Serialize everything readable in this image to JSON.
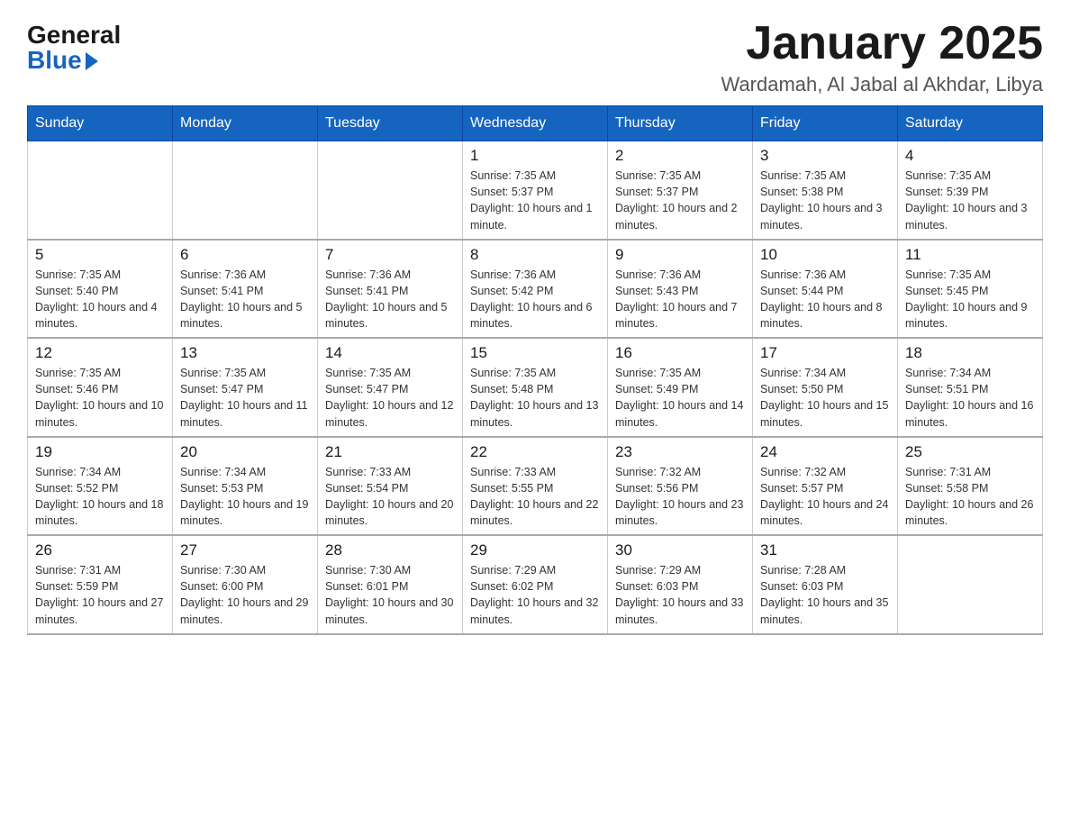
{
  "logo": {
    "general": "General",
    "blue": "Blue"
  },
  "title": "January 2025",
  "subtitle": "Wardamah, Al Jabal al Akhdar, Libya",
  "days_of_week": [
    "Sunday",
    "Monday",
    "Tuesday",
    "Wednesday",
    "Thursday",
    "Friday",
    "Saturday"
  ],
  "weeks": [
    [
      {
        "day": "",
        "info": ""
      },
      {
        "day": "",
        "info": ""
      },
      {
        "day": "",
        "info": ""
      },
      {
        "day": "1",
        "info": "Sunrise: 7:35 AM\nSunset: 5:37 PM\nDaylight: 10 hours and 1 minute."
      },
      {
        "day": "2",
        "info": "Sunrise: 7:35 AM\nSunset: 5:37 PM\nDaylight: 10 hours and 2 minutes."
      },
      {
        "day": "3",
        "info": "Sunrise: 7:35 AM\nSunset: 5:38 PM\nDaylight: 10 hours and 3 minutes."
      },
      {
        "day": "4",
        "info": "Sunrise: 7:35 AM\nSunset: 5:39 PM\nDaylight: 10 hours and 3 minutes."
      }
    ],
    [
      {
        "day": "5",
        "info": "Sunrise: 7:35 AM\nSunset: 5:40 PM\nDaylight: 10 hours and 4 minutes."
      },
      {
        "day": "6",
        "info": "Sunrise: 7:36 AM\nSunset: 5:41 PM\nDaylight: 10 hours and 5 minutes."
      },
      {
        "day": "7",
        "info": "Sunrise: 7:36 AM\nSunset: 5:41 PM\nDaylight: 10 hours and 5 minutes."
      },
      {
        "day": "8",
        "info": "Sunrise: 7:36 AM\nSunset: 5:42 PM\nDaylight: 10 hours and 6 minutes."
      },
      {
        "day": "9",
        "info": "Sunrise: 7:36 AM\nSunset: 5:43 PM\nDaylight: 10 hours and 7 minutes."
      },
      {
        "day": "10",
        "info": "Sunrise: 7:36 AM\nSunset: 5:44 PM\nDaylight: 10 hours and 8 minutes."
      },
      {
        "day": "11",
        "info": "Sunrise: 7:35 AM\nSunset: 5:45 PM\nDaylight: 10 hours and 9 minutes."
      }
    ],
    [
      {
        "day": "12",
        "info": "Sunrise: 7:35 AM\nSunset: 5:46 PM\nDaylight: 10 hours and 10 minutes."
      },
      {
        "day": "13",
        "info": "Sunrise: 7:35 AM\nSunset: 5:47 PM\nDaylight: 10 hours and 11 minutes."
      },
      {
        "day": "14",
        "info": "Sunrise: 7:35 AM\nSunset: 5:47 PM\nDaylight: 10 hours and 12 minutes."
      },
      {
        "day": "15",
        "info": "Sunrise: 7:35 AM\nSunset: 5:48 PM\nDaylight: 10 hours and 13 minutes."
      },
      {
        "day": "16",
        "info": "Sunrise: 7:35 AM\nSunset: 5:49 PM\nDaylight: 10 hours and 14 minutes."
      },
      {
        "day": "17",
        "info": "Sunrise: 7:34 AM\nSunset: 5:50 PM\nDaylight: 10 hours and 15 minutes."
      },
      {
        "day": "18",
        "info": "Sunrise: 7:34 AM\nSunset: 5:51 PM\nDaylight: 10 hours and 16 minutes."
      }
    ],
    [
      {
        "day": "19",
        "info": "Sunrise: 7:34 AM\nSunset: 5:52 PM\nDaylight: 10 hours and 18 minutes."
      },
      {
        "day": "20",
        "info": "Sunrise: 7:34 AM\nSunset: 5:53 PM\nDaylight: 10 hours and 19 minutes."
      },
      {
        "day": "21",
        "info": "Sunrise: 7:33 AM\nSunset: 5:54 PM\nDaylight: 10 hours and 20 minutes."
      },
      {
        "day": "22",
        "info": "Sunrise: 7:33 AM\nSunset: 5:55 PM\nDaylight: 10 hours and 22 minutes."
      },
      {
        "day": "23",
        "info": "Sunrise: 7:32 AM\nSunset: 5:56 PM\nDaylight: 10 hours and 23 minutes."
      },
      {
        "day": "24",
        "info": "Sunrise: 7:32 AM\nSunset: 5:57 PM\nDaylight: 10 hours and 24 minutes."
      },
      {
        "day": "25",
        "info": "Sunrise: 7:31 AM\nSunset: 5:58 PM\nDaylight: 10 hours and 26 minutes."
      }
    ],
    [
      {
        "day": "26",
        "info": "Sunrise: 7:31 AM\nSunset: 5:59 PM\nDaylight: 10 hours and 27 minutes."
      },
      {
        "day": "27",
        "info": "Sunrise: 7:30 AM\nSunset: 6:00 PM\nDaylight: 10 hours and 29 minutes."
      },
      {
        "day": "28",
        "info": "Sunrise: 7:30 AM\nSunset: 6:01 PM\nDaylight: 10 hours and 30 minutes."
      },
      {
        "day": "29",
        "info": "Sunrise: 7:29 AM\nSunset: 6:02 PM\nDaylight: 10 hours and 32 minutes."
      },
      {
        "day": "30",
        "info": "Sunrise: 7:29 AM\nSunset: 6:03 PM\nDaylight: 10 hours and 33 minutes."
      },
      {
        "day": "31",
        "info": "Sunrise: 7:28 AM\nSunset: 6:03 PM\nDaylight: 10 hours and 35 minutes."
      },
      {
        "day": "",
        "info": ""
      }
    ]
  ]
}
